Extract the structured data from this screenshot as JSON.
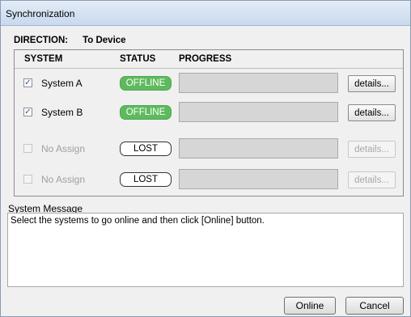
{
  "window": {
    "title": "Synchronization"
  },
  "direction": {
    "label": "DIRECTION:",
    "value": "To Device"
  },
  "table": {
    "headers": {
      "system": "SYSTEM",
      "status": "STATUS",
      "progress": "PROGRESS"
    },
    "rows": [
      {
        "checked": true,
        "enabled": true,
        "checkmark": "✓",
        "name": "System A",
        "status": "OFFLINE",
        "status_kind": "offline",
        "progress": 0,
        "details_label": "details..."
      },
      {
        "checked": true,
        "enabled": true,
        "checkmark": "✓",
        "name": "System B",
        "status": "OFFLINE",
        "status_kind": "offline",
        "progress": 0,
        "details_label": "details..."
      },
      {
        "checked": false,
        "enabled": false,
        "checkmark": "",
        "name": "No Assign",
        "status": "LOST",
        "status_kind": "lost",
        "progress": 0,
        "details_label": "details..."
      },
      {
        "checked": false,
        "enabled": false,
        "checkmark": "",
        "name": "No Assign",
        "status": "LOST",
        "status_kind": "lost",
        "progress": 0,
        "details_label": "details..."
      }
    ]
  },
  "system_message": {
    "label": "System Message",
    "text": "Select the systems to go online and then click [Online] button."
  },
  "buttons": {
    "online": "Online",
    "cancel": "Cancel"
  },
  "colors": {
    "offline_green": "#5fba5f",
    "title_bar": "#c9d9ee"
  }
}
